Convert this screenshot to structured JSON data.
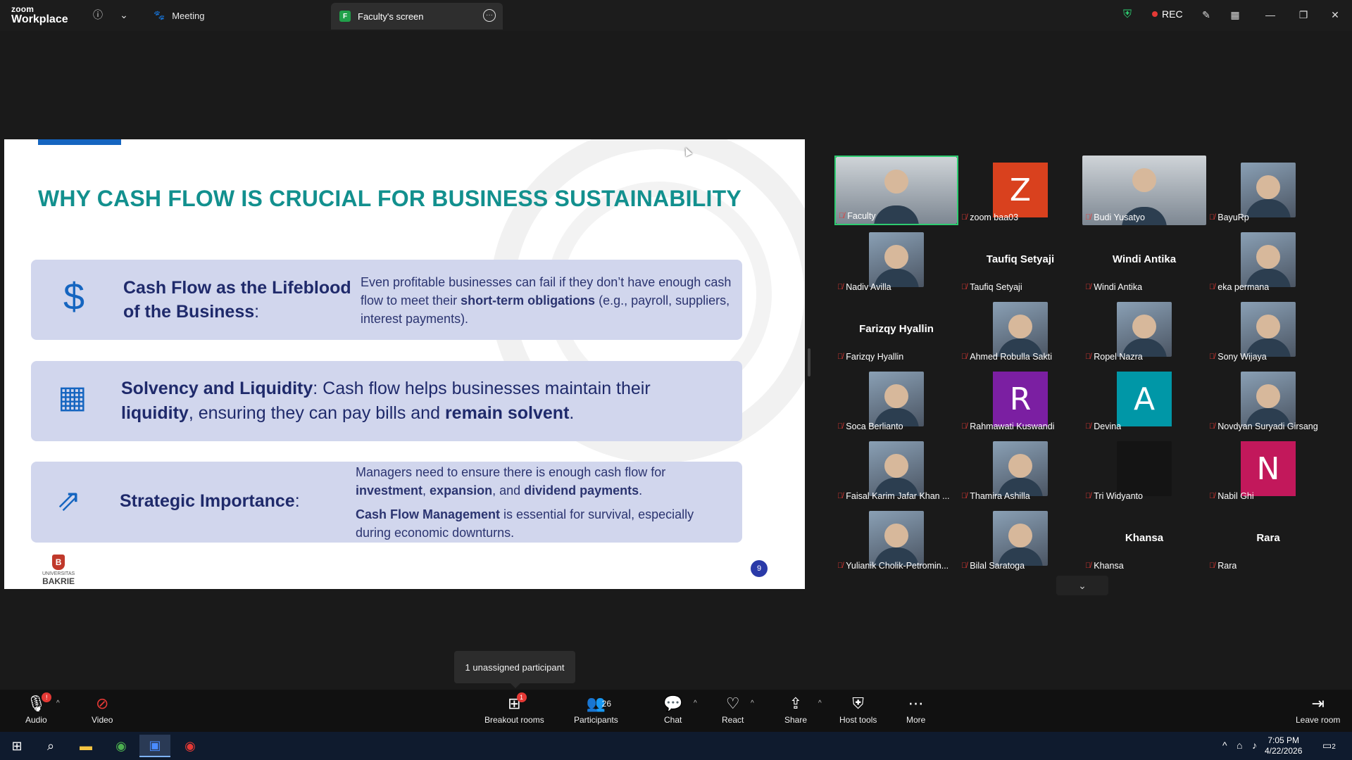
{
  "app": {
    "brand_line1": "zoom",
    "brand_line2": "Workplace"
  },
  "tabs": {
    "meeting": "Meeting",
    "screen": "Faculty's screen",
    "screen_badge": "F"
  },
  "status": {
    "rec": "REC"
  },
  "slide": {
    "title": "WHY CASH FLOW IS CRUCIAL FOR BUSINESS SUSTAINABILITY",
    "card1": {
      "head": "Cash Flow as the Lifeblood of the Business",
      "head_suffix": ":",
      "text_a": "Even profitable businesses can fail if they don’t have enough cash flow to meet their ",
      "text_b": "short-term obligations",
      "text_c": " (e.g., payroll, suppliers, interest payments)."
    },
    "card2": {
      "b1": "Solvency and Liquidity",
      "t1": ": Cash flow helps businesses maintain their ",
      "b2": "liquidity",
      "t2": ", ensuring they can pay bills and ",
      "b3": "remain solvent",
      "t3": "."
    },
    "card3": {
      "head": "Strategic Importance",
      "head_suffix": ":",
      "p1a": "Managers need to ensure there is enough cash flow for ",
      "p1b": "investment",
      "p1c": ", ",
      "p1d": "expansion",
      "p1e": ", and ",
      "p1f": "dividend payments",
      "p1g": ".",
      "p2a": "Cash Flow Management",
      "p2b": " is essential for survival, especially during economic downturns."
    },
    "logo_line1": "UNIVERSITAS",
    "logo_line2": "BAKRIE",
    "logo_mark": "B",
    "page_number": "9"
  },
  "participants_gallery": [
    {
      "name": "Faculty",
      "kind": "video",
      "selected": true
    },
    {
      "name": "zoom baa03",
      "kind": "letter",
      "letter": "Z",
      "color": "#d9411e"
    },
    {
      "name": "Budi Yusatyo",
      "kind": "video"
    },
    {
      "name": "BayuRp",
      "kind": "photo"
    },
    {
      "name": "Nadiv Avilla",
      "kind": "photo"
    },
    {
      "name": "Taufiq Setyaji",
      "kind": "name",
      "display": "Taufiq Setyaji"
    },
    {
      "name": "Windi Antika",
      "kind": "name",
      "display": "Windi Antika"
    },
    {
      "name": "eka permana",
      "kind": "photo"
    },
    {
      "name": "Farizqy Hyallin",
      "kind": "name",
      "display": "Farizqy Hyallin"
    },
    {
      "name": "Ahmed Robulla Sakti",
      "kind": "photo"
    },
    {
      "name": "Ropel Nazra",
      "kind": "photo"
    },
    {
      "name": "Sony Wijaya",
      "kind": "photo"
    },
    {
      "name": "Soca Berlianto",
      "kind": "photo"
    },
    {
      "name": "Rahmawati Kuswandi",
      "kind": "letter",
      "letter": "R",
      "color": "#7b1fa2"
    },
    {
      "name": "Devina",
      "kind": "letter",
      "letter": "A",
      "color": "#0097a7"
    },
    {
      "name": "Novdyan Suryadi Girsang",
      "kind": "photo"
    },
    {
      "name": "Faisal Karim Jafar Khan ...",
      "kind": "photo"
    },
    {
      "name": "Thamira Ashilla",
      "kind": "photo"
    },
    {
      "name": "Tri Widyanto",
      "kind": "dark"
    },
    {
      "name": "Nabil Ghi",
      "kind": "letter",
      "letter": "N",
      "color": "#c2185b"
    },
    {
      "name": "Yulianik Cholik-Petromin...",
      "kind": "photo"
    },
    {
      "name": "Bilal Saratoga",
      "kind": "photo"
    },
    {
      "name": "Khansa",
      "kind": "name",
      "display": "Khansa"
    },
    {
      "name": "Rara",
      "kind": "name",
      "display": "Rara"
    }
  ],
  "tooltip": "1 unassigned participant",
  "toolbar": {
    "audio": "Audio",
    "video": "Video",
    "breakout": "Breakout rooms",
    "breakout_badge": "1",
    "participants": "Participants",
    "participants_count": "26",
    "chat": "Chat",
    "react": "React",
    "share": "Share",
    "host_tools": "Host tools",
    "more": "More",
    "leave": "Leave room",
    "audio_badge": "!"
  },
  "taskbar": {
    "time": "7:05 PM",
    "date": "4/22/2026",
    "notifications": "2"
  },
  "colors": {
    "accent_green": "#2ecc71",
    "title_teal": "#12908e",
    "card_bg": "#d1d6ed",
    "rec_red": "#e53935"
  }
}
